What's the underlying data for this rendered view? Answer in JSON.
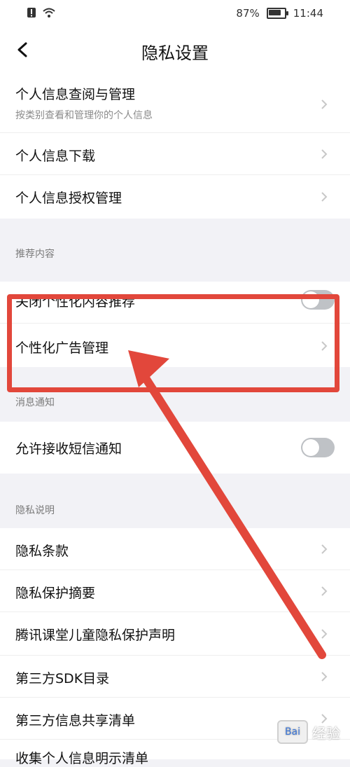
{
  "status_bar": {
    "battery_percent": "87%",
    "battery_level": 0.87,
    "time": "11:44"
  },
  "header": {
    "title": "隐私设置"
  },
  "items": {
    "personal_info_view": {
      "label": "个人信息查阅与管理",
      "subtitle": "按类别查看和管理你的个人信息"
    },
    "personal_info_download": {
      "label": "个人信息下载"
    },
    "personal_info_auth": {
      "label": "个人信息授权管理"
    },
    "recommend_section": "推荐内容",
    "close_personalized": {
      "label": "关闭个性化内容推荐",
      "toggle": false
    },
    "personalized_ads": {
      "label": "个性化广告管理"
    },
    "message_section": "消息通知",
    "allow_sms": {
      "label": "允许接收短信通知",
      "toggle": false
    },
    "privacy_section": "隐私说明",
    "privacy_terms": {
      "label": "隐私条款"
    },
    "privacy_summary": {
      "label": "隐私保护摘要"
    },
    "children_privacy": {
      "label": "腾讯课堂儿童隐私保护声明"
    },
    "third_sdk": {
      "label": "第三方SDK目录"
    },
    "third_share": {
      "label": "第三方信息共享清单"
    },
    "collect_list": {
      "label": "收集个人信息明示清单"
    }
  },
  "watermark": {
    "text": "经验",
    "logo_text": "Bai"
  },
  "colors": {
    "accent": "#e2473b",
    "toggle_off": "#bfc2c6",
    "background": "#f2f2f6"
  }
}
